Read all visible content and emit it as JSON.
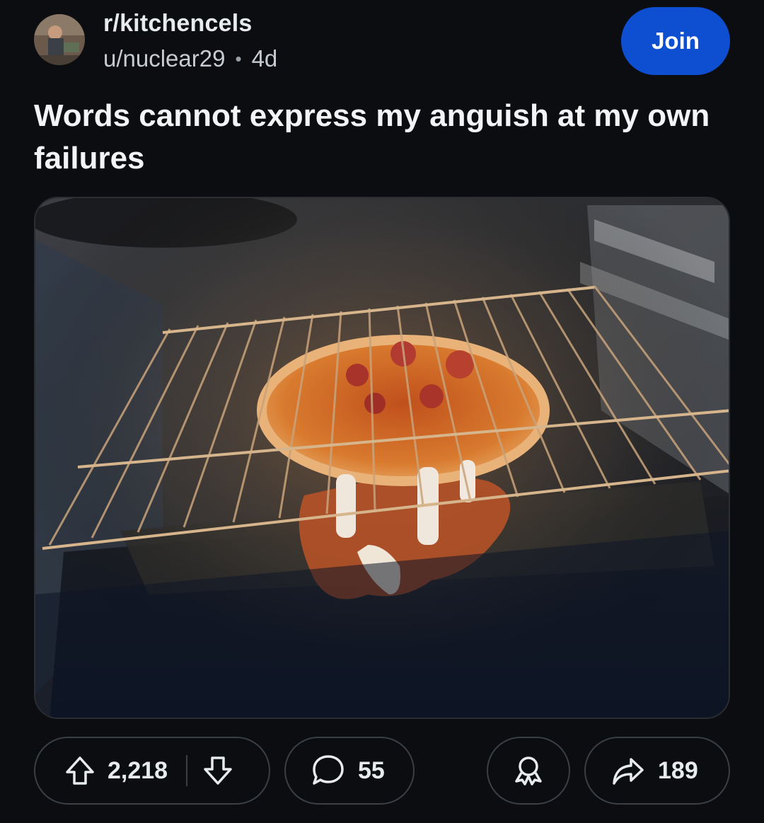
{
  "header": {
    "subreddit": "r/kitchencels",
    "username": "u/nuclear29",
    "separator": "•",
    "age": "4d",
    "join_label": "Join"
  },
  "post": {
    "title": "Words cannot express my anguish at my own failures"
  },
  "actions": {
    "upvotes": "2,218",
    "comments": "55",
    "shares": "189"
  },
  "colors": {
    "join_button": "#0e4fd1",
    "background": "#0b0d10"
  },
  "icons": {
    "upvote": "arrow-up-icon",
    "downvote": "arrow-down-icon",
    "comment": "speech-bubble-icon",
    "award": "award-icon",
    "share": "share-arrow-icon"
  }
}
